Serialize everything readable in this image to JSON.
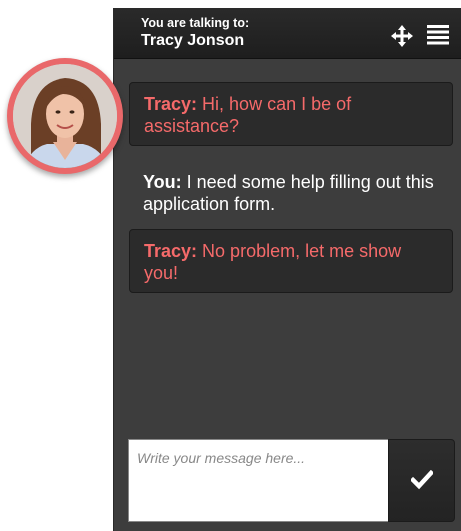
{
  "header": {
    "label": "You are talking to:",
    "name": "Tracy Jonson"
  },
  "icons": {
    "move": "move-arrows-icon",
    "menu": "hamburger-menu-icon",
    "send": "checkmark-icon"
  },
  "messages": [
    {
      "sender": "Tracy:",
      "text": " Hi, how can I be of assistance?",
      "from_agent": true
    },
    {
      "sender": "You:",
      "text": " I need some help filling out this application form.",
      "from_agent": false
    },
    {
      "sender": "Tracy:",
      "text": " No problem, let me show you!",
      "from_agent": true
    }
  ],
  "composer": {
    "placeholder": "Write your message here...",
    "value": ""
  },
  "colors": {
    "accent": "#f56a6a",
    "avatar_ring": "#e9686a",
    "panel": "#3d3d3d",
    "bubble": "#2b2b2b",
    "header": "#1e1e1e"
  }
}
